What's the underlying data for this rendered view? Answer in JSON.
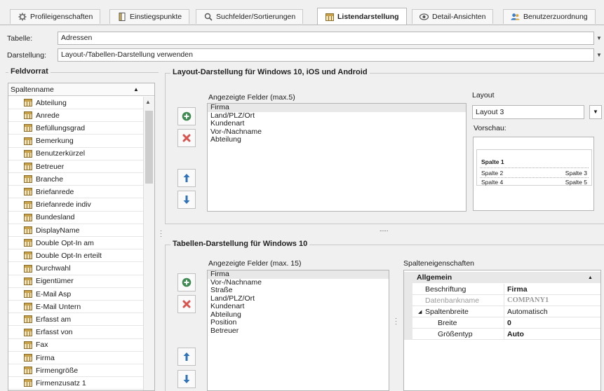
{
  "tabs": [
    {
      "label": "Profileigenschaften",
      "icon": "gear-icon"
    },
    {
      "label": "Einstiegspunkte",
      "icon": "document-icon"
    },
    {
      "label": "Suchfelder/Sortierungen",
      "icon": "search-icon"
    },
    {
      "label": "Listendarstellung",
      "icon": "table-icon"
    },
    {
      "label": "Detail-Ansichten",
      "icon": "eye-icon"
    },
    {
      "label": "Benutzerzuordnung",
      "icon": "users-icon"
    }
  ],
  "form": {
    "tabelle_label": "Tabelle:",
    "tabelle_value": "Adressen",
    "darstellung_label": "Darstellung:",
    "darstellung_value": "Layout-/Tabellen-Darstellung verwenden"
  },
  "feldvorrat": {
    "title": "Feldvorrat",
    "column_header": "Spaltenname",
    "items": [
      "Abteilung",
      "Anrede",
      "Befüllungsgrad",
      "Bemerkung",
      "Benutzerkürzel",
      "Betreuer",
      "Branche",
      "Briefanrede",
      "Briefanrede indiv",
      "Bundesland",
      "DisplayName",
      "Double Opt-In am",
      "Double Opt-In erteilt",
      "Durchwahl",
      "Eigentümer",
      "E-Mail Asp",
      "E-Mail Untern",
      "Erfasst am",
      "Erfasst von",
      "Fax",
      "Firma",
      "Firmengröße",
      "Firmenzusatz 1"
    ]
  },
  "layout_group": {
    "title": "Layout-Darstellung für Windows 10, iOS und Android",
    "fields_label": "Angezeigte Felder (max.5)",
    "fields": [
      "Firma",
      "Land/PLZ/Ort",
      "Kundenart",
      "Vor-/Nachname",
      "Abteilung"
    ],
    "layout_label": "Layout",
    "layout_value": "Layout 3",
    "preview_label": "Vorschau:",
    "preview": {
      "col1": "Spalte 1",
      "col2": "Spalte 2",
      "col3": "Spalte 3",
      "col4": "Spalte 4",
      "col5": "Spalte 5"
    }
  },
  "splitter_handle": ".....",
  "table_group": {
    "title": "Tabellen-Darstellung für Windows 10",
    "fields_label": "Angezeigte Felder (max. 15)",
    "fields": [
      "Firma",
      "Vor-/Nachname",
      "Straße",
      "Land/PLZ/Ort",
      "Kundenart",
      "Abteilung",
      "Position",
      "Betreuer"
    ],
    "props_label": "Spalteneigenschaften",
    "props": {
      "category": "Allgemein",
      "rows": [
        {
          "key": "Beschriftung",
          "value": "Firma"
        },
        {
          "key": "Datenbankname",
          "value": "COMPANY1"
        },
        {
          "key": "Spaltenbreite",
          "value": "Automatisch"
        },
        {
          "key": "Breite",
          "value": "0"
        },
        {
          "key": "Größentyp",
          "value": "Auto"
        }
      ]
    }
  },
  "colors": {
    "add_green": "#3f8a52",
    "delete_red": "#d9534f",
    "arrow_blue": "#2e72b8",
    "accent_blue": "#3b7ecb"
  }
}
